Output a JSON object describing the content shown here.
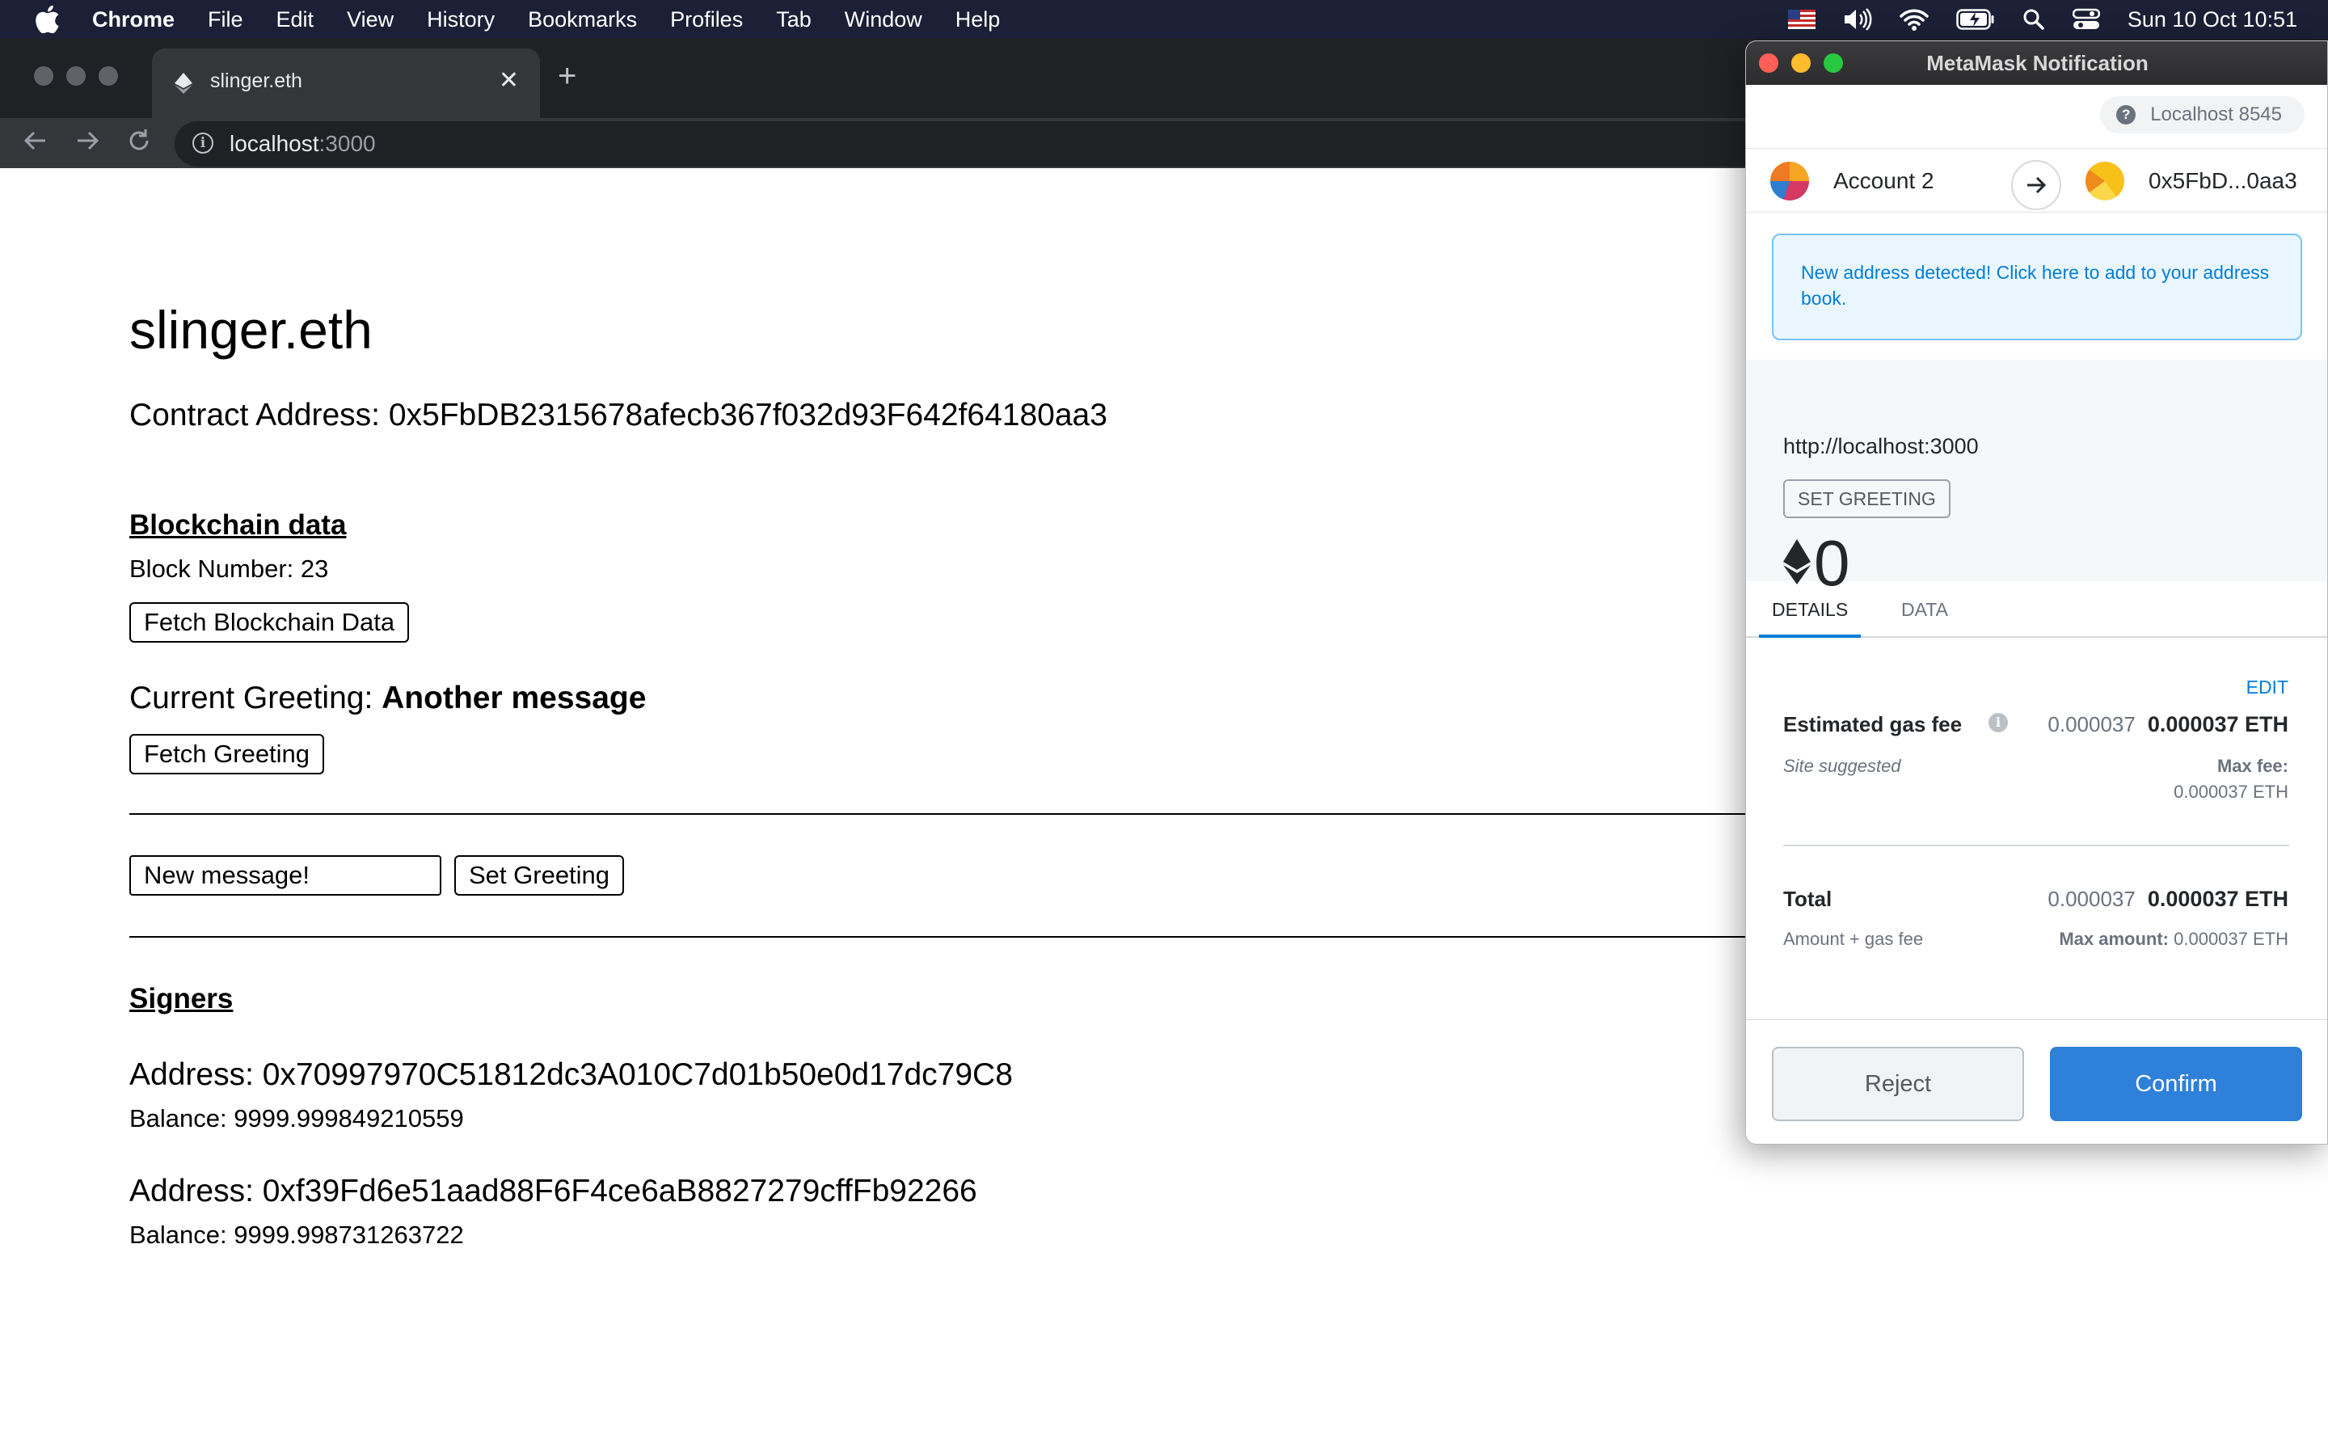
{
  "menubar": {
    "app": "Chrome",
    "items": [
      "File",
      "Edit",
      "View",
      "History",
      "Bookmarks",
      "Profiles",
      "Tab",
      "Window",
      "Help"
    ],
    "clock": "Sun 10 Oct  10:51"
  },
  "browser": {
    "tab_title": "slinger.eth",
    "url_host": "localhost",
    "url_port": ":3000"
  },
  "page": {
    "title": "slinger.eth",
    "contract_address_label": "Contract Address: 0x5FbDB2315678afecb367f032d93F642f64180aa3",
    "blockchain_heading": "Blockchain data",
    "block_number": "Block Number: 23",
    "fetch_blockchain_button": "Fetch Blockchain Data",
    "greeting_label": "Current Greeting: ",
    "greeting_value": "Another message",
    "fetch_greeting_button": "Fetch Greeting",
    "message_input_value": "New message!",
    "set_greeting_button": "Set Greeting",
    "signers_heading": "Signers",
    "signers": [
      {
        "address": "Address: 0x70997970C51812dc3A010C7d01b50e0d17dc79C8",
        "balance": "Balance: 9999.999849210559"
      },
      {
        "address": "Address: 0xf39Fd6e51aad88F6F4ce6aB8827279cffFb92266",
        "balance": "Balance: 9999.998731263722"
      }
    ]
  },
  "metamask": {
    "window_title": "MetaMask Notification",
    "network": "Localhost 8545",
    "from_account": "Account 2",
    "to_address": "0x5FbD...0aa3",
    "notice": "New address detected! Click here to add to your address book.",
    "origin": "http://localhost:3000",
    "method_badge": "SET GREETING",
    "amount": "0",
    "tabs": [
      "DETAILS",
      "DATA"
    ],
    "edit_link": "EDIT",
    "gas_label": "Estimated gas fee",
    "gas_value_light": "0.000037",
    "gas_value_bold": "0.000037 ETH",
    "site_suggested": "Site suggested",
    "max_fee_label": "Max fee:",
    "max_fee_value": "0.000037 ETH",
    "total_label": "Total",
    "total_value_light": "0.000037",
    "total_value_bold": "0.000037 ETH",
    "amount_gas_label": "Amount + gas fee",
    "max_amount_label": "Max amount:",
    "max_amount_value": "0.000037 ETH",
    "reject_button": "Reject",
    "confirm_button": "Confirm"
  },
  "colors": {
    "menubar_bg": "#1b2036",
    "metamask_blue": "#037dd6",
    "confirm_bg": "#2f80d8"
  }
}
